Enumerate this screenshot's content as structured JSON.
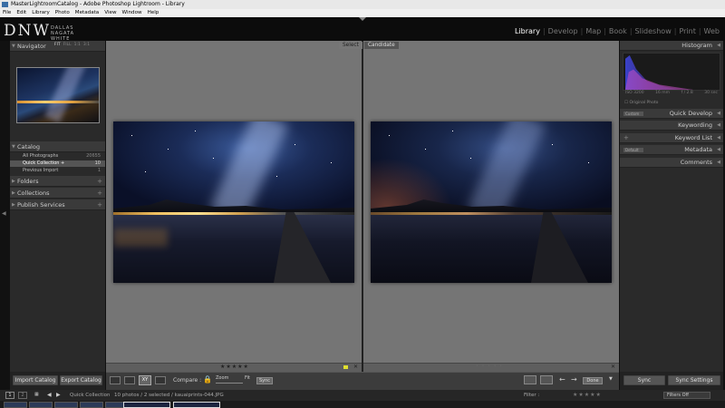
{
  "window": {
    "title": "MasterLightroomCatalog - Adobe Photoshop Lightroom - Library"
  },
  "menu": [
    "File",
    "Edit",
    "Library",
    "Photo",
    "Metadata",
    "View",
    "Window",
    "Help"
  ],
  "identity": {
    "logo": "DNW",
    "subtitle": "DALLAS NAGATA WHITE PHOTOGRAPHY"
  },
  "modules": [
    {
      "label": "Library",
      "active": true
    },
    {
      "label": "Develop",
      "active": false
    },
    {
      "label": "Map",
      "active": false
    },
    {
      "label": "Book",
      "active": false
    },
    {
      "label": "Slideshow",
      "active": false
    },
    {
      "label": "Print",
      "active": false
    },
    {
      "label": "Web",
      "active": false
    }
  ],
  "left": {
    "navigator": {
      "title": "Navigator",
      "options": [
        "FIT",
        "FILL",
        "1:1",
        "3:1"
      ]
    },
    "catalog": {
      "title": "Catalog",
      "rows": [
        {
          "label": "All Photographs",
          "count": "20655"
        },
        {
          "label": "Quick Collection +",
          "count": "10"
        },
        {
          "label": "Previous Import",
          "count": "1"
        }
      ]
    },
    "folders": "Folders",
    "collections": "Collections",
    "publish": "Publish Services",
    "import_btn": "Import Catalog",
    "export_btn": "Export Catalog"
  },
  "compare": {
    "select_label": "Select",
    "candidate_label": "Candidate",
    "stars": "★★★★★",
    "candidate_stars": "• • • • •"
  },
  "right": {
    "histogram": {
      "title": "Histogram",
      "iso": "ISO 3200",
      "focal": "16 mm",
      "aperture": "f / 2.8",
      "shutter": "30 sec",
      "original": "Original Photo"
    },
    "quick_develop": "Quick Develop",
    "quick_develop_preset": "Custom",
    "keywording": "Keywording",
    "keyword_list": "Keyword List",
    "metadata": "Metadata",
    "metadata_preset": "Default",
    "comments": "Comments",
    "sync_btn": "Sync",
    "sync_settings_btn": "Sync Settings"
  },
  "toolbar": {
    "compare_label": "Compare :",
    "zoom_label": "Zoom",
    "fit_label": "Fit",
    "sync_label": "Sync",
    "done_label": "Done"
  },
  "filmbar": {
    "pages": [
      "1",
      "2"
    ],
    "source": "Quick Collection",
    "info": "10 photos / 2 selected / kauaiprints-044.JPG",
    "filter_label": "Filter :",
    "filters_off": "Filters Off"
  }
}
